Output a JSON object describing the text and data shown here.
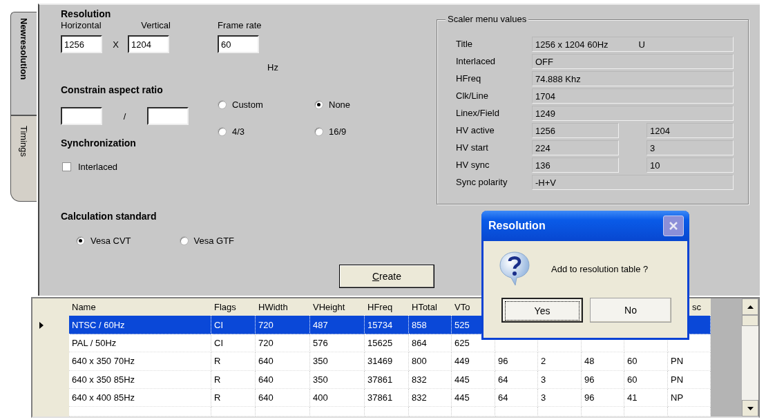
{
  "tabs": [
    {
      "label": "Newresolution",
      "selected": true
    },
    {
      "label": "Timings",
      "selected": false
    }
  ],
  "resolution": {
    "heading": "Resolution",
    "horizontal_label": "Horizontal",
    "vertical_label": "Vertical",
    "frame_rate_label": "Frame rate",
    "horizontal": "1256",
    "times": "X",
    "vertical": "1204",
    "frame_rate": "60",
    "unit": "Hz"
  },
  "aspect": {
    "heading": "Constrain aspect ratio",
    "slash": "/",
    "options": [
      {
        "label": "Custom",
        "selected": false
      },
      {
        "label": "None",
        "selected": true
      },
      {
        "label": "4/3",
        "selected": false
      },
      {
        "label": "16/9",
        "selected": false
      }
    ]
  },
  "sync": {
    "heading": "Synchronization",
    "interlaced": {
      "label": "Interlaced",
      "checked": false
    }
  },
  "calc": {
    "heading": "Calculation standard",
    "options": [
      {
        "label": "Vesa CVT",
        "selected": true
      },
      {
        "label": "Vesa GTF",
        "selected": false
      }
    ]
  },
  "create_button": "Create",
  "scaler": {
    "title": "Scaler menu values",
    "rows": [
      {
        "label": "Title",
        "kind": "single",
        "values": [
          "1256 x 1204 60Hz",
          "U"
        ]
      },
      {
        "label": "Interlaced",
        "kind": "single",
        "values": [
          "OFF"
        ]
      },
      {
        "label": "HFreq",
        "kind": "single",
        "values": [
          "74.888 Khz"
        ]
      },
      {
        "label": "Clk/Line",
        "kind": "single",
        "values": [
          "1704"
        ]
      },
      {
        "label": "Linex/Field",
        "kind": "single",
        "values": [
          "1249"
        ]
      },
      {
        "label": "HV active",
        "kind": "pair",
        "values": [
          "1256",
          "1204"
        ]
      },
      {
        "label": "HV start",
        "kind": "pair",
        "values": [
          "224",
          "3"
        ]
      },
      {
        "label": "HV sync",
        "kind": "pair",
        "values": [
          "136",
          "10"
        ]
      },
      {
        "label": "Sync polarity",
        "kind": "single",
        "values": [
          "-H+V"
        ]
      }
    ]
  },
  "table": {
    "columns": [
      "Name",
      "Flags",
      "HWidth",
      "VHeight",
      "HFreq",
      "HTotal",
      "VTo",
      null,
      null,
      null,
      null,
      "sc"
    ],
    "rows": [
      {
        "selected": true,
        "cells": [
          "NTSC / 60Hz",
          "CI",
          "720",
          "487",
          "15734",
          "858",
          "525",
          null,
          null,
          null,
          null,
          null
        ]
      },
      {
        "selected": false,
        "cells": [
          "PAL / 50Hz",
          "CI",
          "720",
          "576",
          "15625",
          "864",
          "625",
          null,
          null,
          null,
          null,
          null
        ]
      },
      {
        "selected": false,
        "cells": [
          "640 x 350 70Hz",
          "R",
          "640",
          "350",
          "31469",
          "800",
          "449",
          "96",
          "2",
          "48",
          "60",
          "PN"
        ]
      },
      {
        "selected": false,
        "cells": [
          "640 x 350 85Hz",
          "R",
          "640",
          "350",
          "37861",
          "832",
          "445",
          "64",
          "3",
          "96",
          "60",
          "PN"
        ]
      },
      {
        "selected": false,
        "cells": [
          "640 x 400 85Hz",
          "R",
          "640",
          "400",
          "37861",
          "832",
          "445",
          "64",
          "3",
          "96",
          "41",
          "NP"
        ]
      }
    ]
  },
  "dialog": {
    "title": "Resolution",
    "message": "Add to resolution table ?",
    "buttons": [
      {
        "label": "Yes",
        "default": true
      },
      {
        "label": "No",
        "default": false
      }
    ]
  }
}
